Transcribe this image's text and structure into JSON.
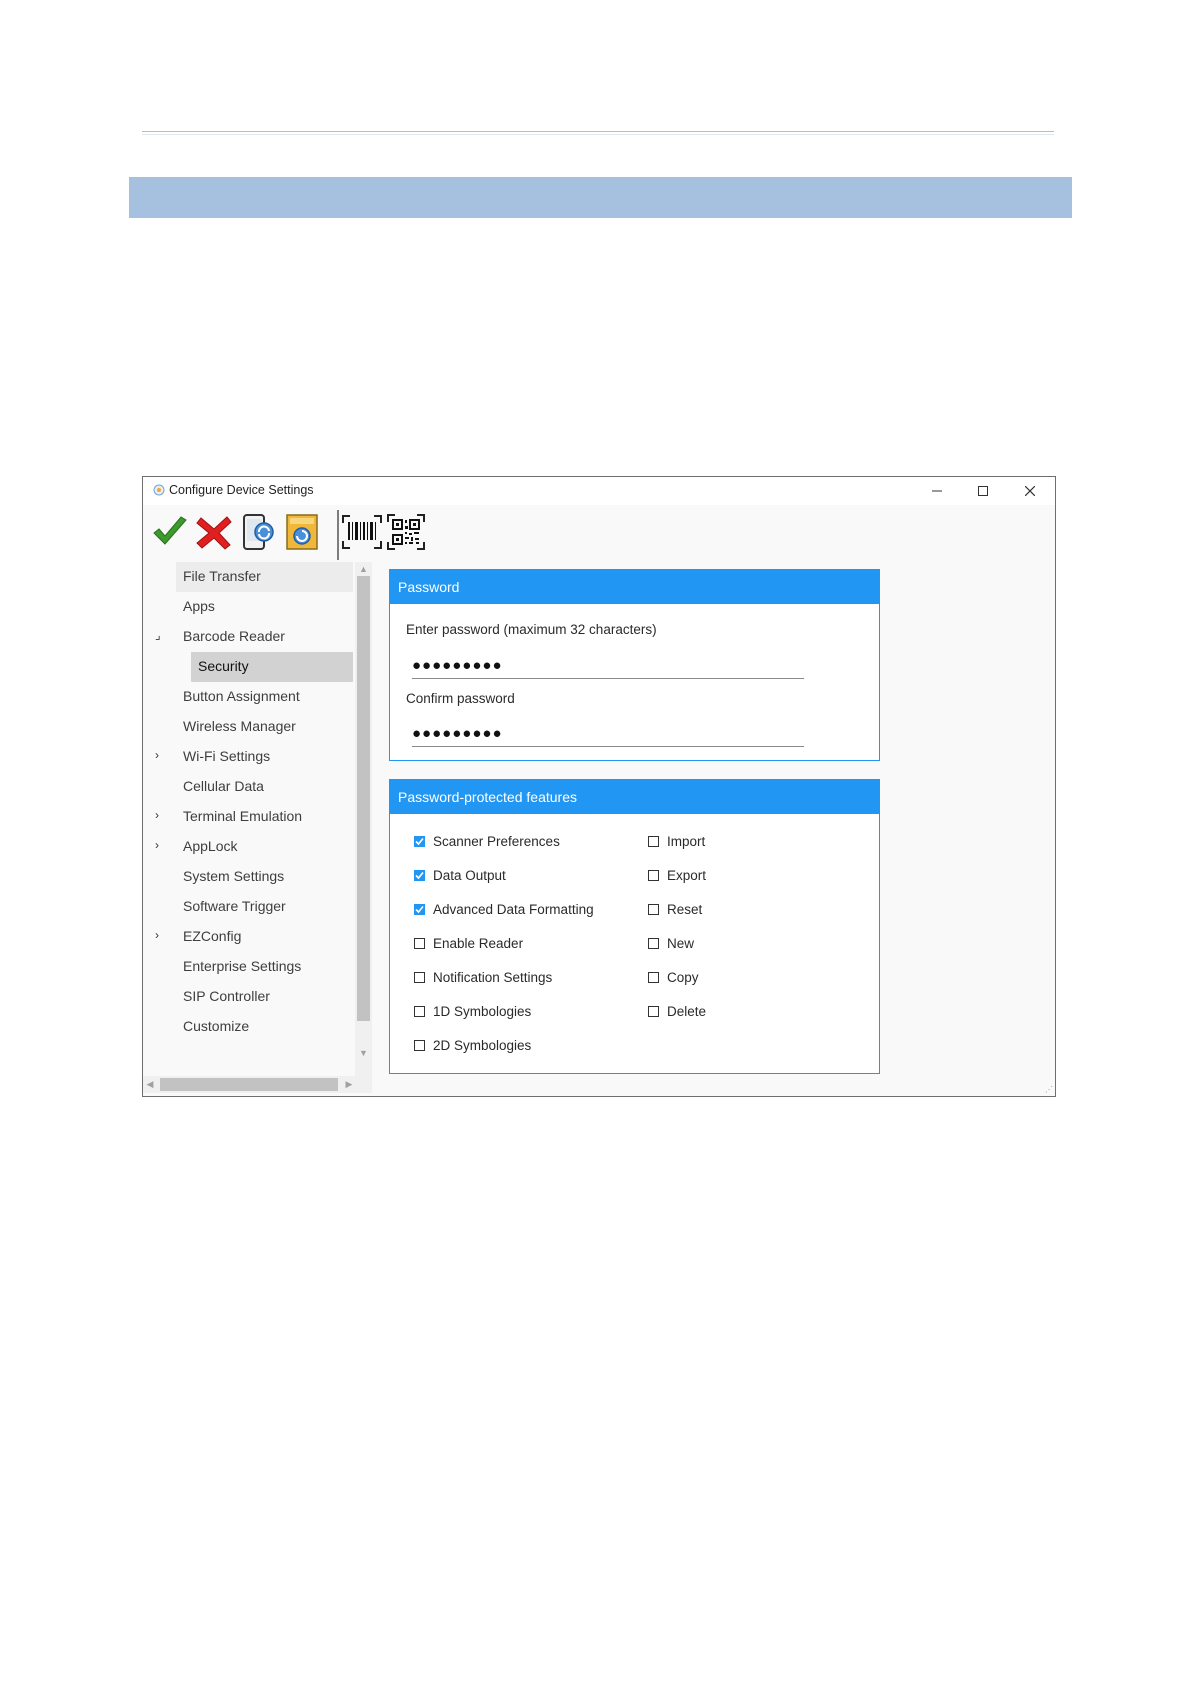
{
  "window": {
    "title": "Configure Device Settings",
    "controls": {
      "minimize": "—",
      "maximize": "☐",
      "close": "✕"
    }
  },
  "toolbar": {
    "buttons": [
      {
        "name": "apply-button",
        "icon": "green-check-icon"
      },
      {
        "name": "cancel-button",
        "icon": "red-x-icon"
      },
      {
        "name": "refresh-device-button",
        "icon": "device-refresh-icon"
      },
      {
        "name": "restore-button",
        "icon": "restore-icon"
      },
      {
        "name": "barcode-button",
        "icon": "barcode-icon"
      },
      {
        "name": "qr-code-button",
        "icon": "qr-code-icon"
      }
    ]
  },
  "nav": {
    "items": [
      {
        "label": "File Transfer",
        "expander": ""
      },
      {
        "label": "Apps",
        "expander": ""
      },
      {
        "label": "Barcode Reader",
        "expander": "⌟"
      },
      {
        "label": "Security",
        "expander": ""
      },
      {
        "label": "Button Assignment",
        "expander": ""
      },
      {
        "label": "Wireless Manager",
        "expander": ""
      },
      {
        "label": "Wi-Fi Settings",
        "expander": "›"
      },
      {
        "label": "Cellular Data",
        "expander": ""
      },
      {
        "label": "Terminal Emulation",
        "expander": "›"
      },
      {
        "label": "AppLock",
        "expander": "›"
      },
      {
        "label": "System Settings",
        "expander": ""
      },
      {
        "label": "Software Trigger",
        "expander": ""
      },
      {
        "label": "EZConfig",
        "expander": "›"
      },
      {
        "label": "Enterprise Settings",
        "expander": ""
      },
      {
        "label": "SIP Controller",
        "expander": ""
      },
      {
        "label": "Customize",
        "expander": ""
      }
    ],
    "selected": "Security"
  },
  "password_panel": {
    "title": "Password",
    "enter_label": "Enter password (maximum 32 characters)",
    "enter_value": "●●●●●●●●●",
    "confirm_label": "Confirm password",
    "confirm_value": "●●●●●●●●●"
  },
  "features_panel": {
    "title": "Password-protected features",
    "left": [
      {
        "label": "Scanner Preferences",
        "checked": true
      },
      {
        "label": "Data Output",
        "checked": true
      },
      {
        "label": "Advanced Data Formatting",
        "checked": true
      },
      {
        "label": "Enable Reader",
        "checked": false
      },
      {
        "label": "Notification Settings",
        "checked": false
      },
      {
        "label": "1D Symbologies",
        "checked": false
      },
      {
        "label": "2D Symbologies",
        "checked": false
      }
    ],
    "right": [
      {
        "label": "Import",
        "checked": false
      },
      {
        "label": "Export",
        "checked": false
      },
      {
        "label": "Reset",
        "checked": false
      },
      {
        "label": "New",
        "checked": false
      },
      {
        "label": "Copy",
        "checked": false
      },
      {
        "label": "Delete",
        "checked": false
      }
    ]
  },
  "colors": {
    "accent": "#2196f3",
    "heading_bar": "#a6c1df",
    "selected_item": "#d2d2d2"
  }
}
